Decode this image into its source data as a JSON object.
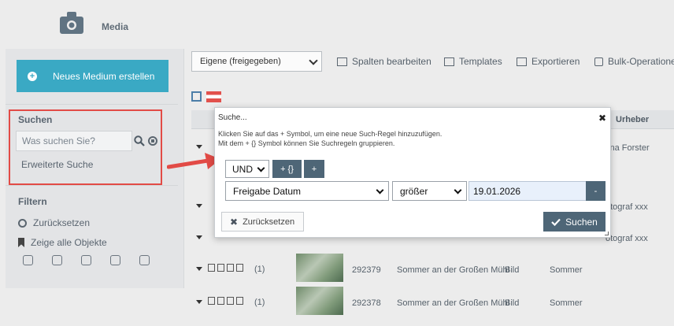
{
  "app": {
    "title": "Media"
  },
  "sidebar": {
    "new_button": "Neues Medium erstellen",
    "search": {
      "title": "Suchen",
      "placeholder": "Was suchen Sie?",
      "advanced_link": "Erweiterte Suche"
    },
    "filter": {
      "title": "Filtern",
      "reset": "Zurücksetzen",
      "show_all": "Zeige alle Objekte"
    }
  },
  "toolbar": {
    "filter_select": "Eigene (freigegeben)",
    "edit_columns": "Spalten bearbeiten",
    "templates": "Templates",
    "export": "Exportieren",
    "bulk": "Bulk-Operationen"
  },
  "table": {
    "header_author": "Urheber",
    "rows": [
      {
        "author": "tina Forster"
      },
      {
        "author": "otograf xxx"
      },
      {
        "author": "otograf xxx"
      },
      {
        "count": "(1)",
        "id": "292379",
        "title": "Sommer an der Großen Mühl",
        "type": "Bild",
        "keyword": "Sommer"
      },
      {
        "count": "(1)",
        "id": "292378",
        "title": "Sommer an der Großen Mühl",
        "type": "Bild",
        "keyword": "Sommer"
      }
    ]
  },
  "dialog": {
    "title": "Suche...",
    "help_line1": "Klicken Sie auf das + Symbol, um eine neue Such-Regel hinzuzufügen.",
    "help_line2": "Mit dem + {} Symbol können Sie Suchregeln gruppieren.",
    "operator": "UND",
    "group_button": "+ {}",
    "add_button": "+",
    "field": "Freigabe Datum",
    "comparator": "größer",
    "value": "19.01.2026",
    "remove_button": "-",
    "reset_button": "Zurücksetzen",
    "search_button": "Suchen"
  },
  "colors": {
    "accent": "#3aa9c4",
    "dark_button": "#4e6677",
    "highlight": "#e24b46"
  }
}
